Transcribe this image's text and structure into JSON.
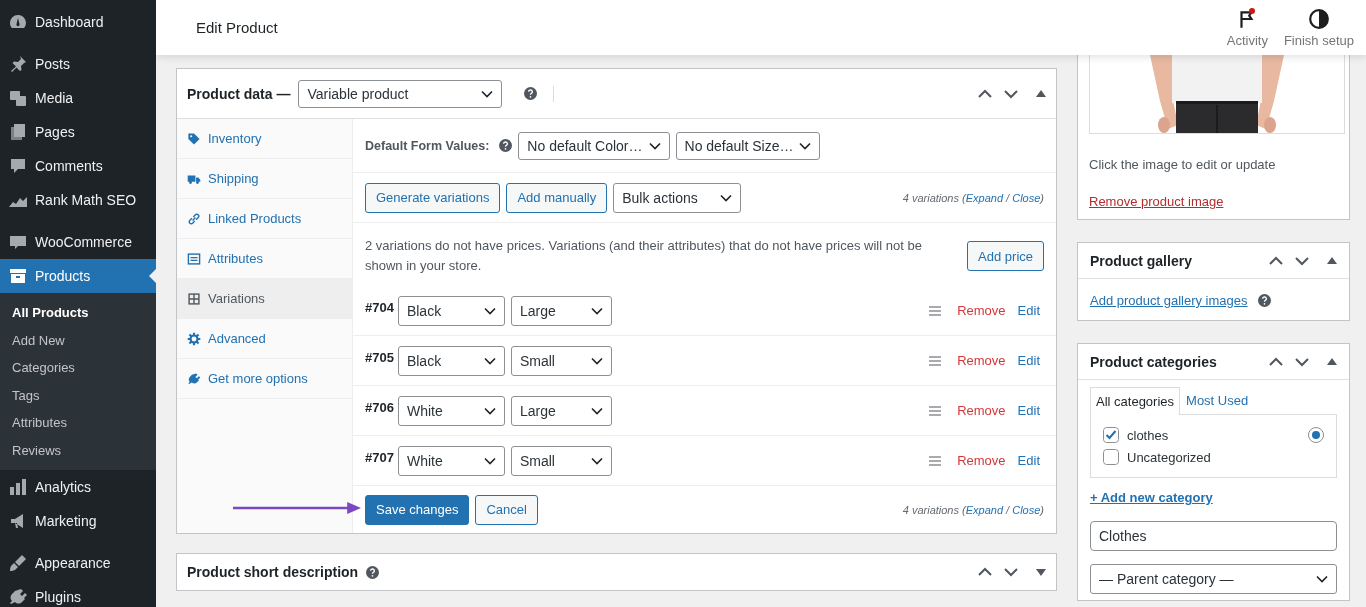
{
  "sidebar": {
    "groups": [
      [
        {
          "label": "Dashboard",
          "kind": "gauge",
          "selected": false
        }
      ],
      [
        {
          "label": "Posts",
          "kind": "pin",
          "selected": false
        },
        {
          "label": "Media",
          "kind": "media",
          "selected": false
        },
        {
          "label": "Pages",
          "kind": "pages",
          "selected": false
        },
        {
          "label": "Comments",
          "kind": "comment",
          "selected": false
        },
        {
          "label": "Rank Math SEO",
          "kind": "chart",
          "selected": false
        }
      ],
      [
        {
          "label": "WooCommerce",
          "kind": "woo",
          "selected": false
        },
        {
          "label": "Products",
          "kind": "box",
          "selected": true,
          "children": [
            {
              "label": "All Products",
              "selected": true
            },
            {
              "label": "Add New",
              "selected": false
            },
            {
              "label": "Categories",
              "selected": false
            },
            {
              "label": "Tags",
              "selected": false
            },
            {
              "label": "Attributes",
              "selected": false
            },
            {
              "label": "Reviews",
              "selected": false
            }
          ]
        },
        {
          "label": "Analytics",
          "kind": "bars",
          "selected": false
        },
        {
          "label": "Marketing",
          "kind": "megaphone",
          "selected": false
        }
      ],
      [
        {
          "label": "Appearance",
          "kind": "brush",
          "selected": false
        },
        {
          "label": "Plugins",
          "kind": "plug",
          "selected": false
        }
      ]
    ]
  },
  "header": {
    "title": "Edit Product",
    "actions": [
      {
        "label": "Activity",
        "kind": "flag",
        "unread": true
      },
      {
        "label": "Finish setup",
        "kind": "progress",
        "unread": false
      }
    ]
  },
  "product_data": {
    "title": "Product data —",
    "product_type": "Variable product",
    "expanded": true,
    "tabs": [
      {
        "label": "Inventory",
        "kind": "tag",
        "selected": false
      },
      {
        "label": "Shipping",
        "kind": "truck",
        "selected": false
      },
      {
        "label": "Linked Products",
        "kind": "link",
        "selected": false
      },
      {
        "label": "Attributes",
        "kind": "list",
        "selected": false
      },
      {
        "label": "Variations",
        "kind": "grid",
        "selected": true
      },
      {
        "label": "Advanced",
        "kind": "gear",
        "selected": false
      },
      {
        "label": "Get more options",
        "kind": "plug",
        "selected": false
      }
    ],
    "default_values": {
      "label": "Default Form Values:",
      "selects": [
        "No default Color…",
        "No default Size…"
      ]
    },
    "toolbar": {
      "buttons": [
        "Generate variations",
        "Add manually"
      ],
      "bulk": "Bulk actions",
      "count": "4 variations (",
      "expand": "Expand",
      "separator": " / ",
      "close": "Close",
      "end": ")"
    },
    "notice": {
      "text": "2 variations do not have prices. Variations (and their attributes) that do not have prices will not be shown in your store.",
      "button": "Add price"
    },
    "variations": [
      {
        "number": "#704",
        "color_option": "Black",
        "size_option": "Large",
        "remove": "Remove",
        "edit": "Edit"
      },
      {
        "number": "#705",
        "color_option": "Black",
        "size_option": "Small",
        "remove": "Remove",
        "edit": "Edit"
      },
      {
        "number": "#706",
        "color_option": "White",
        "size_option": "Large",
        "remove": "Remove",
        "edit": "Edit"
      },
      {
        "number": "#707",
        "color_option": "White",
        "size_option": "Small",
        "remove": "Remove",
        "edit": "Edit"
      }
    ],
    "footer": {
      "save": "Save changes",
      "cancel": "Cancel",
      "count": "4 variations (",
      "expand": "Expand",
      "separator": " / ",
      "close": "Close",
      "end": ")"
    }
  },
  "short_description": {
    "title": "Product short description",
    "expanded": false
  },
  "product_image": {
    "hint": "Click the image to edit or update",
    "remove": "Remove product image"
  },
  "product_gallery": {
    "title": "Product gallery",
    "expanded": true,
    "link": "Add product gallery images"
  },
  "product_categories": {
    "title": "Product categories",
    "expanded": true,
    "tabs": [
      {
        "label": "All categories",
        "selected": true
      },
      {
        "label": "Most Used",
        "selected": false
      }
    ],
    "items": [
      {
        "label": "clothes",
        "checked": true,
        "primary": true
      },
      {
        "label": "Uncategorized",
        "checked": false,
        "primary": false
      }
    ],
    "add_link": "+ Add new category",
    "new_category": {
      "value": "Clothes"
    },
    "parent": "— Parent category —"
  }
}
